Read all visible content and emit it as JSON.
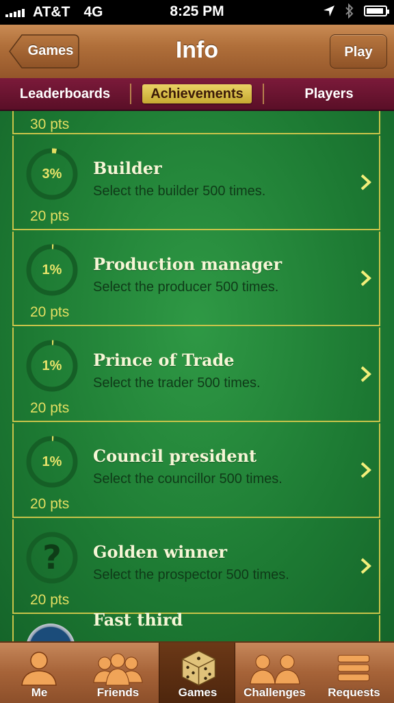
{
  "status": {
    "carrier": "AT&T",
    "network": "4G",
    "time": "8:25 PM"
  },
  "nav": {
    "back_label": "Games",
    "title": "Info",
    "play_label": "Play"
  },
  "segments": [
    {
      "label": "Leaderboards",
      "selected": false
    },
    {
      "label": "Achievements",
      "selected": true
    },
    {
      "label": "Players",
      "selected": false
    }
  ],
  "partial_top_pts": "30 pts",
  "achievements": [
    {
      "title": "Builder",
      "desc": "Select the builder 500 times.",
      "progress": "3%",
      "progress_value": 0.03,
      "pts": "20 pts",
      "locked": false
    },
    {
      "title": "Production manager",
      "desc": "Select the producer 500 times.",
      "progress": "1%",
      "progress_value": 0.01,
      "pts": "20 pts",
      "locked": false
    },
    {
      "title": "Prince of Trade",
      "desc": "Select the trader 500 times.",
      "progress": "1%",
      "progress_value": 0.01,
      "pts": "20 pts",
      "locked": false
    },
    {
      "title": "Council president",
      "desc": "Select the councillor 500 times.",
      "progress": "1%",
      "progress_value": 0.01,
      "pts": "20 pts",
      "locked": false
    },
    {
      "title": "Golden winner",
      "desc": "Select the prospector 500 times.",
      "progress": "?",
      "progress_value": 0,
      "pts": "20 pts",
      "locked": true
    }
  ],
  "partial_bottom_title": "Fast third",
  "tabs": [
    {
      "label": "Me",
      "icon": "person-icon",
      "selected": false
    },
    {
      "label": "Friends",
      "icon": "friends-icon",
      "selected": false
    },
    {
      "label": "Games",
      "icon": "dice-icon",
      "selected": true
    },
    {
      "label": "Challenges",
      "icon": "challenges-icon",
      "selected": false
    },
    {
      "label": "Requests",
      "icon": "requests-icon",
      "selected": false
    }
  ],
  "colors": {
    "felt": "#1d7a33",
    "border": "#c9c44a",
    "wood": "#b06f3a",
    "segment": "#6b1530"
  }
}
